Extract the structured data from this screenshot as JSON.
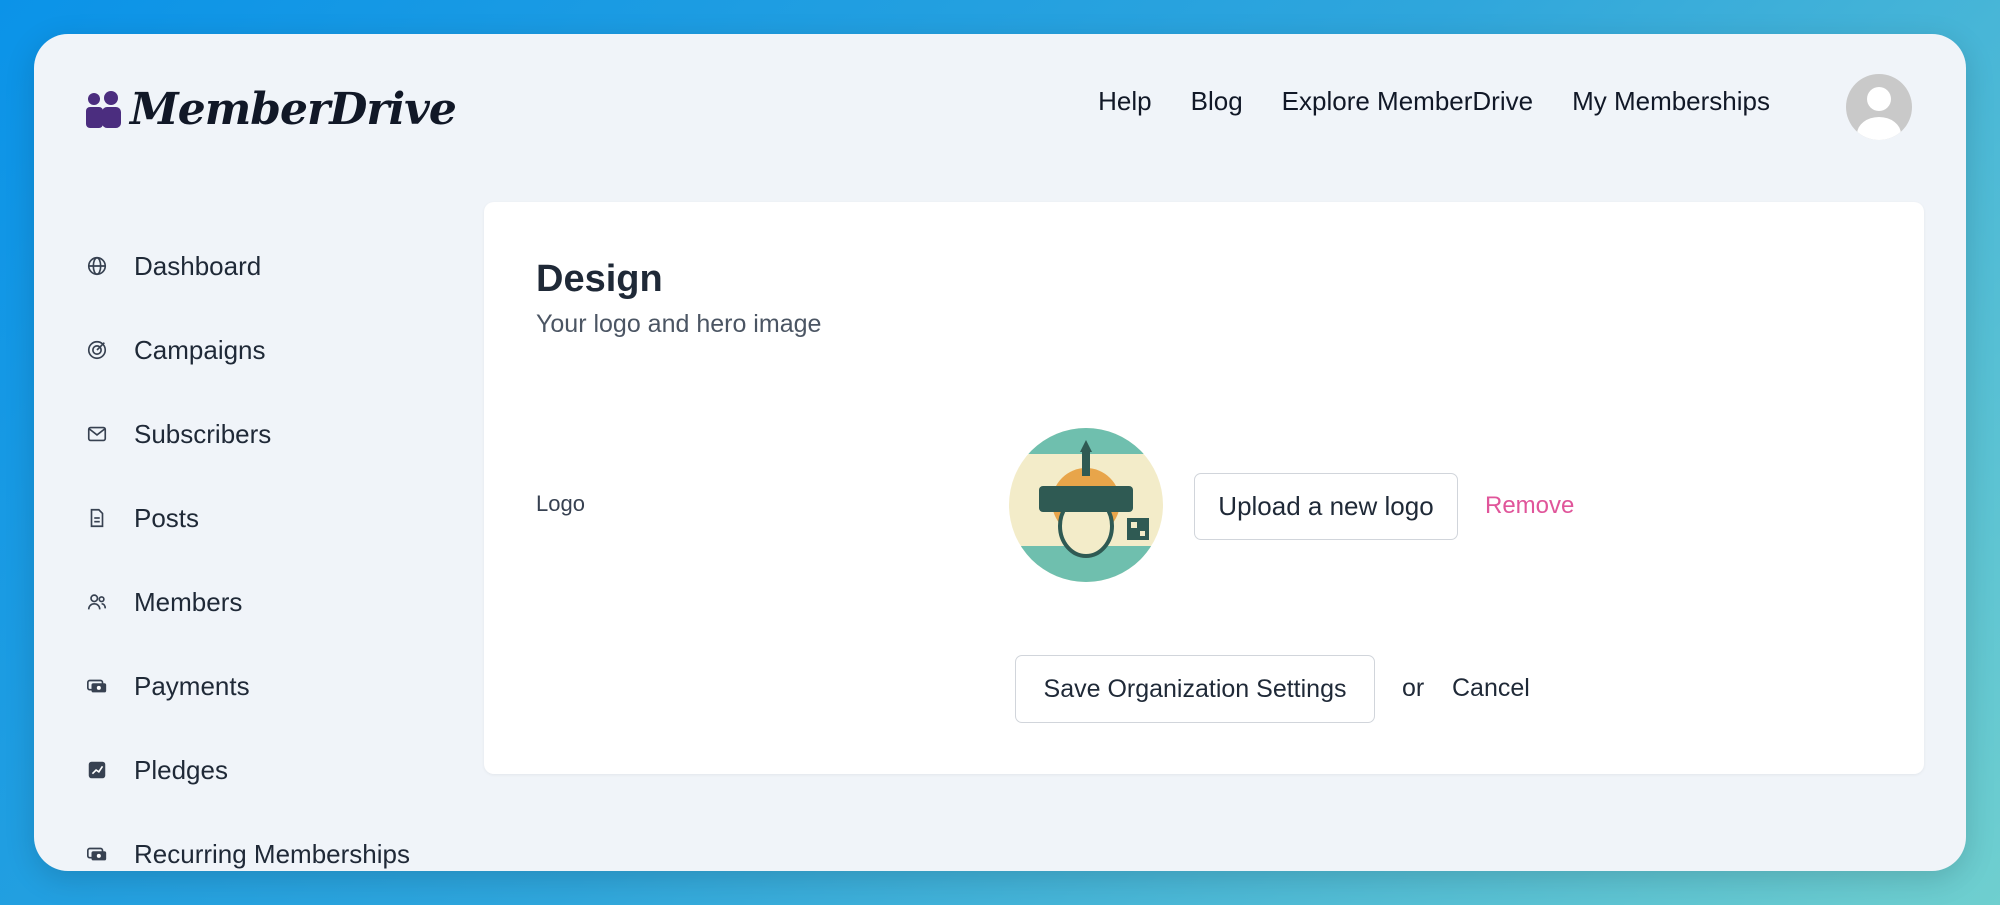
{
  "app": {
    "brand": "MemberDrive",
    "accent_color": "#e0559a",
    "brand_color": "#4b2d7f"
  },
  "topnav": {
    "items": [
      {
        "label": "Help"
      },
      {
        "label": "Blog"
      },
      {
        "label": "Explore MemberDrive"
      },
      {
        "label": "My Memberships"
      }
    ],
    "avatar_icon": "user-avatar-icon"
  },
  "sidebar": {
    "items": [
      {
        "label": "Dashboard",
        "icon": "globe-icon"
      },
      {
        "label": "Campaigns",
        "icon": "target-icon"
      },
      {
        "label": "Subscribers",
        "icon": "envelope-icon"
      },
      {
        "label": "Posts",
        "icon": "document-icon"
      },
      {
        "label": "Members",
        "icon": "users-icon"
      },
      {
        "label": "Payments",
        "icon": "cash-icon"
      },
      {
        "label": "Pledges",
        "icon": "chart-icon"
      },
      {
        "label": "Recurring Memberships",
        "icon": "cash-icon"
      }
    ]
  },
  "design": {
    "title": "Design",
    "subtitle": "Your logo and hero image",
    "logo_label": "Logo",
    "upload_label": "Upload a new logo",
    "remove_label": "Remove",
    "save_label": "Save Organization Settings",
    "or_label": "or",
    "cancel_label": "Cancel"
  }
}
